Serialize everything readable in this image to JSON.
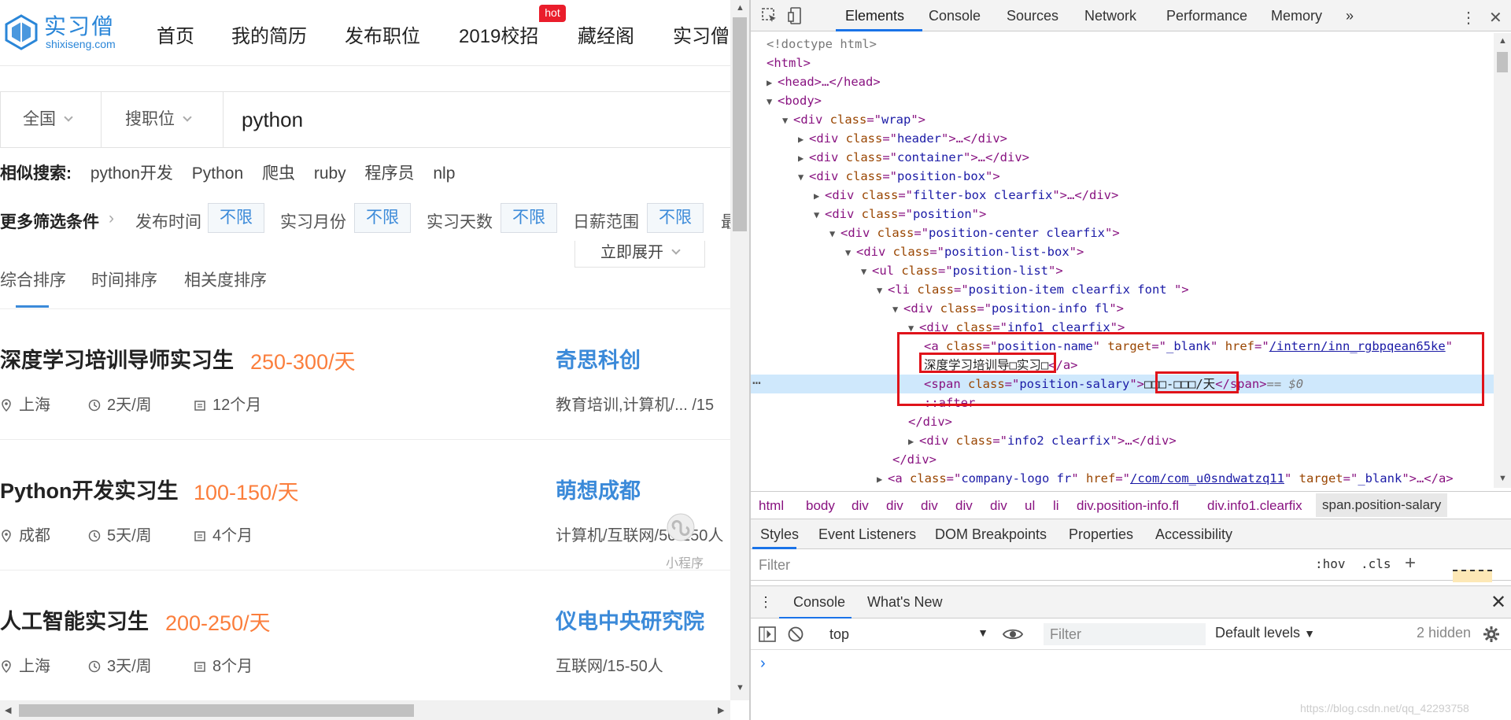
{
  "site": {
    "logo_cn": "实习僧",
    "logo_en": "shixiseng.com",
    "nav": [
      "首页",
      "我的简历",
      "发布职位",
      "2019校招",
      "藏经阁",
      "实习僧"
    ],
    "hot_badge": "hot"
  },
  "search": {
    "region": "全国",
    "type": "搜职位",
    "query": "python"
  },
  "similar": {
    "label": "相似搜索:",
    "items": [
      "python开发",
      "Python",
      "爬虫",
      "ruby",
      "程序员",
      "nlp"
    ]
  },
  "filters": {
    "more_label": "更多筛选条件",
    "items": [
      {
        "label": "发布时间",
        "value": "不限"
      },
      {
        "label": "实习月份",
        "value": "不限"
      },
      {
        "label": "实习天数",
        "value": "不限"
      },
      {
        "label": "日薪范围",
        "value": "不限"
      }
    ],
    "truncated": "最",
    "expand_label": "立即展开"
  },
  "sorts": [
    "综合排序",
    "时间排序",
    "相关度排序"
  ],
  "jobs": [
    {
      "title": "深度学习培训导师实习生",
      "salary": "250-300/天",
      "company": "奇思科创",
      "city": "上海",
      "days": "2天/周",
      "months": "12个月",
      "company_meta": "教育培训,计算机/...   /15"
    },
    {
      "title": "Python开发实习生",
      "salary": "100-150/天",
      "company": "萌想成都",
      "city": "成都",
      "days": "5天/周",
      "months": "4个月",
      "company_meta": "计算机/互联网/50-150人"
    },
    {
      "title": "人工智能实习生",
      "salary": "200-250/天",
      "company": "仪电中央研究院",
      "city": "上海",
      "days": "3天/周",
      "months": "8个月",
      "company_meta": "互联网/15-50人"
    }
  ],
  "mini_program": "小程序",
  "devtools": {
    "tabs": [
      "Elements",
      "Console",
      "Sources",
      "Network",
      "Performance",
      "Memory",
      "»"
    ],
    "dom": {
      "l0": "<!doctype html>",
      "l1": "<html>",
      "l2_tag": "<head>",
      "l2_rest": "…</head>",
      "l3": "<body>",
      "wrap_class": "wrap",
      "header_class": "header",
      "container_class": "container",
      "position_box_class": "position-box",
      "filter_box_class": "filter-box clearfix",
      "position_class": "position",
      "position_center_class": "position-center clearfix",
      "position_list_box_class": "position-list-box",
      "position_list_class": "position-list",
      "position_item_class": "position-item clearfix font ",
      "position_info_class": "position-info fl",
      "info1_class": "info1 clearfix",
      "a_class": "position-name",
      "a_target": "_blank",
      "a_href": "/intern/inn_rgbpqean65ke",
      "a_text": "深度学习培训导□实习□",
      "span_class": "position-salary",
      "span_text": "□□□-□□□/天",
      "span_eq": "== $0",
      "after": "::after",
      "info2_class": "info2 clearfix",
      "logo_class": "company-logo fr",
      "logo_href": "/com/com_u0sndwatzq11",
      "logo_target": "_blank"
    },
    "breadcrumbs": [
      "html",
      "body",
      "div",
      "div",
      "div",
      "div",
      "div",
      "ul",
      "li",
      "div.position-info.fl",
      "div.info1.clearfix",
      "span.position-salary"
    ],
    "styles_tabs": [
      "Styles",
      "Event Listeners",
      "DOM Breakpoints",
      "Properties",
      "Accessibility"
    ],
    "filter_placeholder": "Filter",
    "hov": ":hov",
    "cls": ".cls",
    "drawer_tabs": [
      "Console",
      "What's New"
    ],
    "context": "top",
    "console_filter": "Filter",
    "levels": "Default levels",
    "hidden": "2 hidden",
    "prompt": "›"
  },
  "watermark": "https://blog.csdn.net/qq_42293758"
}
